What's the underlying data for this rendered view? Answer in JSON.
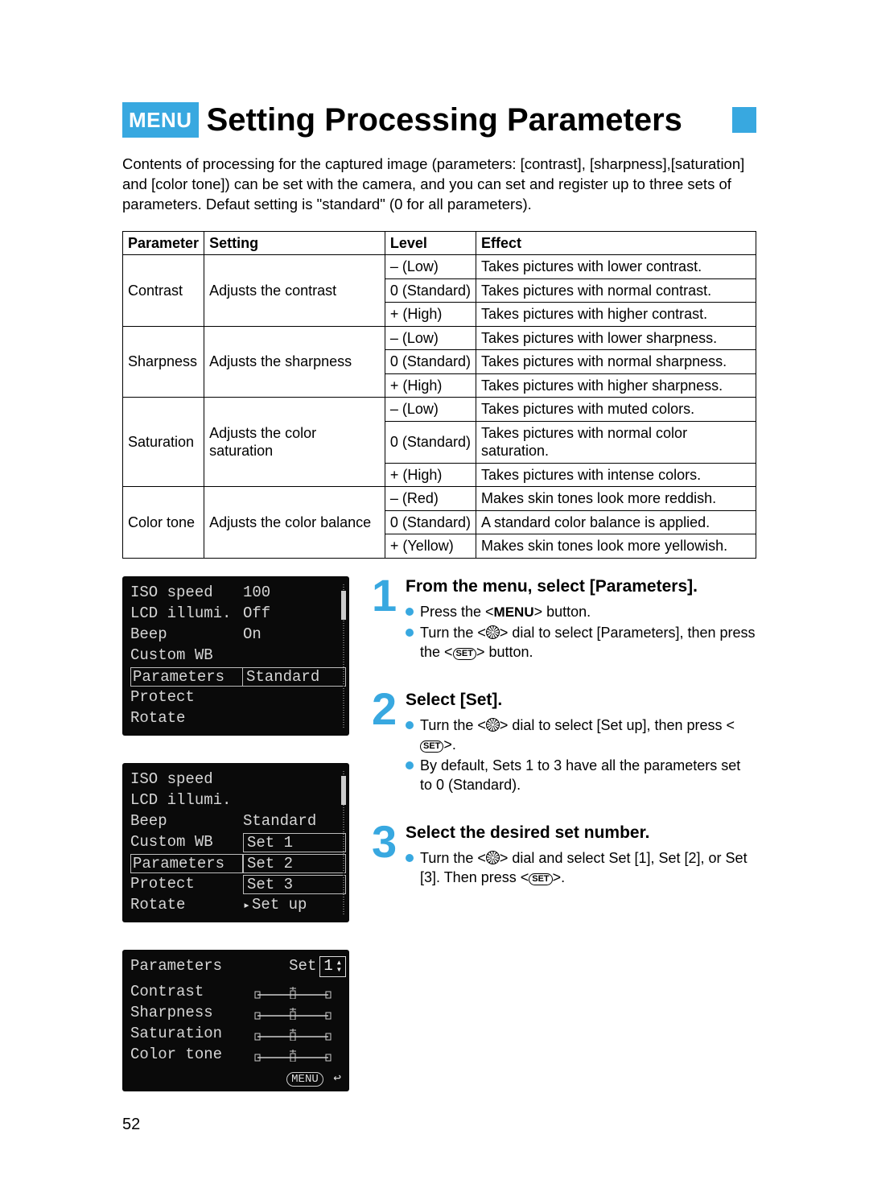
{
  "title": {
    "badge": "MENU",
    "text": "Setting Processing Parameters"
  },
  "intro": "Contents of processing for the captured image (parameters: [contrast], [sharpness],[saturation] and [color tone]) can be set with the camera, and you can set and register up to three sets of parameters. Defaut setting is \"standard\" (0 for all parameters).",
  "table": {
    "headers": [
      "Parameter",
      "Setting",
      "Level",
      "Effect"
    ],
    "rows": [
      {
        "param": "Contrast",
        "setting": "Adjusts the contrast",
        "levels": [
          {
            "l": "– (Low)",
            "e": "Takes pictures with lower contrast."
          },
          {
            "l": "0 (Standard)",
            "e": "Takes pictures with normal contrast."
          },
          {
            "l": "+ (High)",
            "e": "Takes pictures with higher contrast."
          }
        ]
      },
      {
        "param": "Sharpness",
        "setting": "Adjusts the sharpness",
        "levels": [
          {
            "l": "– (Low)",
            "e": "Takes pictures with lower sharpness."
          },
          {
            "l": "0 (Standard)",
            "e": "Takes pictures with normal sharpness."
          },
          {
            "l": "+ (High)",
            "e": "Takes pictures with higher sharpness."
          }
        ]
      },
      {
        "param": "Saturation",
        "setting": "Adjusts the color saturation",
        "levels": [
          {
            "l": "– (Low)",
            "e": "Takes pictures with muted colors."
          },
          {
            "l": "0 (Standard)",
            "e": "Takes pictures with normal color saturation."
          },
          {
            "l": "+ (High)",
            "e": "Takes pictures with intense colors."
          }
        ]
      },
      {
        "param": "Color tone",
        "setting": "Adjusts the color balance",
        "levels": [
          {
            "l": "– (Red)",
            "e": "Makes skin tones look more reddish."
          },
          {
            "l": "0 (Standard)",
            "e": "A standard color balance is applied."
          },
          {
            "l": "+ (Yellow)",
            "e": "Makes skin tones look more yellowish."
          }
        ]
      }
    ]
  },
  "lcd1": {
    "rows": [
      {
        "k": "ISO speed",
        "v": "100"
      },
      {
        "k": "LCD illumi.",
        "v": "Off"
      },
      {
        "k": "Beep",
        "v": "On"
      },
      {
        "k": "Custom WB",
        "v": ""
      },
      {
        "k": "Parameters",
        "v": "Standard",
        "boxed": true
      },
      {
        "k": "Protect",
        "v": ""
      },
      {
        "k": "Rotate",
        "v": ""
      }
    ]
  },
  "lcd2": {
    "rows": [
      {
        "k": "ISO speed",
        "v": ""
      },
      {
        "k": "LCD illumi.",
        "v": ""
      },
      {
        "k": "Beep",
        "v": "Standard"
      },
      {
        "k": "Custom WB",
        "v": "Set 1",
        "vboxed": true
      },
      {
        "k": "Parameters",
        "v": "Set 2",
        "vboxed": true,
        "kboxed": true
      },
      {
        "k": "Protect",
        "v": "Set 3",
        "vboxed": true
      },
      {
        "k": "Rotate",
        "v": "Set up",
        "sel": true
      }
    ]
  },
  "lcd3": {
    "title_label": "Parameters",
    "set_label": "Set",
    "set_num": "1",
    "params": [
      "Contrast",
      "Sharpness",
      "Saturation",
      "Color tone"
    ],
    "return_label": "MENU"
  },
  "steps": [
    {
      "num": "1",
      "title": "From the menu, select [Parameters].",
      "bullets": [
        {
          "pre": "Press the <",
          "menu": "MENU",
          "post": "> button."
        },
        {
          "pre": "Turn the <",
          "dial": true,
          "mid": "> dial to select [Parameters], then press the <",
          "set": true,
          "post": "> button."
        }
      ]
    },
    {
      "num": "2",
      "title": "Select [Set].",
      "bullets": [
        {
          "pre": "Turn the <",
          "dial": true,
          "mid": "> dial to select [Set up], then press <",
          "set": true,
          "post": ">."
        },
        {
          "pre": "By default, Sets 1 to 3 have all the parameters set to 0 (Standard)."
        }
      ]
    },
    {
      "num": "3",
      "title": "Select the desired set number.",
      "bullets": [
        {
          "pre": "Turn the <",
          "dial": true,
          "mid": ">  dial and select Set [1], Set [2], or Set [3]. Then press <",
          "set": true,
          "post": ">."
        }
      ]
    }
  ],
  "page_number": "52",
  "inline_set_label": "SET"
}
